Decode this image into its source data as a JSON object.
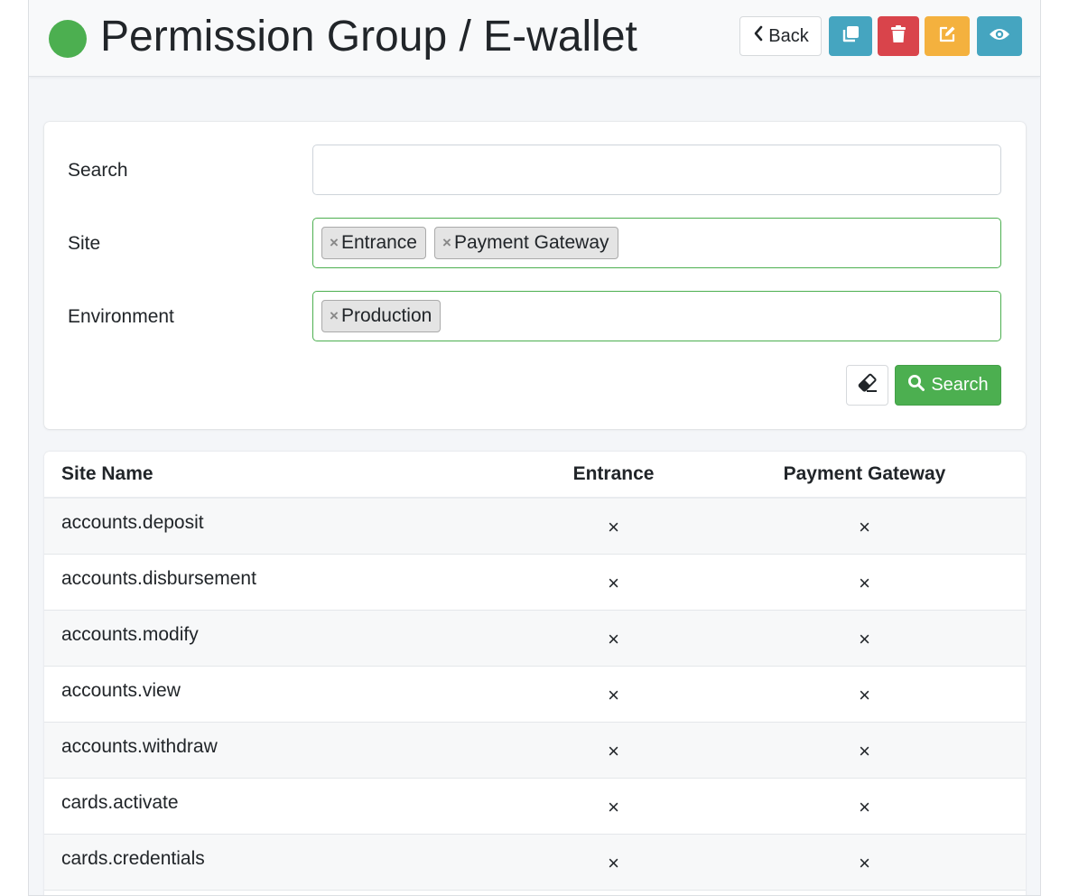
{
  "header": {
    "title": "Permission Group / E-wallet",
    "back_label": "Back",
    "status_color": "#4caf50"
  },
  "filters": {
    "search_label": "Search",
    "search_value": "",
    "site_label": "Site",
    "site_tags": [
      "Entrance",
      "Payment Gateway"
    ],
    "environment_label": "Environment",
    "environment_tags": [
      "Production"
    ],
    "tag_remove_symbol": "×",
    "search_button_label": "Search"
  },
  "table": {
    "headers": [
      "Site Name",
      "Entrance",
      "Payment Gateway"
    ],
    "rows": [
      {
        "name": "accounts.deposit",
        "entrance": "×",
        "payment_gateway": "×"
      },
      {
        "name": "accounts.disbursement",
        "entrance": "×",
        "payment_gateway": "×"
      },
      {
        "name": "accounts.modify",
        "entrance": "×",
        "payment_gateway": "×"
      },
      {
        "name": "accounts.view",
        "entrance": "×",
        "payment_gateway": "×"
      },
      {
        "name": "accounts.withdraw",
        "entrance": "×",
        "payment_gateway": "×"
      },
      {
        "name": "cards.activate",
        "entrance": "×",
        "payment_gateway": "×"
      },
      {
        "name": "cards.credentials",
        "entrance": "×",
        "payment_gateway": "×"
      }
    ]
  },
  "colors": {
    "success": "#4caf50",
    "info": "#45a5c0",
    "danger": "#d9444b",
    "warning": "#f4b13e"
  }
}
